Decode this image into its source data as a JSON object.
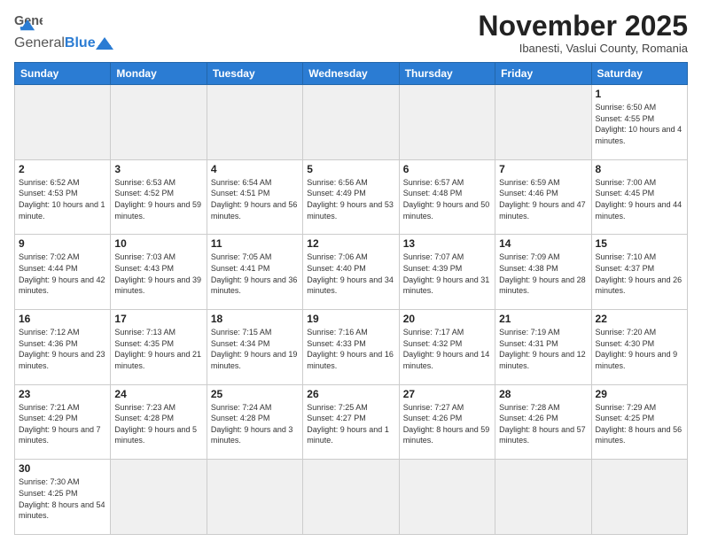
{
  "header": {
    "logo_general": "General",
    "logo_blue": "Blue",
    "month_title": "November 2025",
    "subtitle": "Ibanesti, Vaslui County, Romania"
  },
  "weekdays": [
    "Sunday",
    "Monday",
    "Tuesday",
    "Wednesday",
    "Thursday",
    "Friday",
    "Saturday"
  ],
  "weeks": [
    [
      {
        "day": "",
        "info": "",
        "empty": true
      },
      {
        "day": "",
        "info": "",
        "empty": true
      },
      {
        "day": "",
        "info": "",
        "empty": true
      },
      {
        "day": "",
        "info": "",
        "empty": true
      },
      {
        "day": "",
        "info": "",
        "empty": true
      },
      {
        "day": "",
        "info": "",
        "empty": true
      },
      {
        "day": "1",
        "info": "Sunrise: 6:50 AM\nSunset: 4:55 PM\nDaylight: 10 hours and 4 minutes."
      }
    ],
    [
      {
        "day": "2",
        "info": "Sunrise: 6:52 AM\nSunset: 4:53 PM\nDaylight: 10 hours and 1 minute."
      },
      {
        "day": "3",
        "info": "Sunrise: 6:53 AM\nSunset: 4:52 PM\nDaylight: 9 hours and 59 minutes."
      },
      {
        "day": "4",
        "info": "Sunrise: 6:54 AM\nSunset: 4:51 PM\nDaylight: 9 hours and 56 minutes."
      },
      {
        "day": "5",
        "info": "Sunrise: 6:56 AM\nSunset: 4:49 PM\nDaylight: 9 hours and 53 minutes."
      },
      {
        "day": "6",
        "info": "Sunrise: 6:57 AM\nSunset: 4:48 PM\nDaylight: 9 hours and 50 minutes."
      },
      {
        "day": "7",
        "info": "Sunrise: 6:59 AM\nSunset: 4:46 PM\nDaylight: 9 hours and 47 minutes."
      },
      {
        "day": "8",
        "info": "Sunrise: 7:00 AM\nSunset: 4:45 PM\nDaylight: 9 hours and 44 minutes."
      }
    ],
    [
      {
        "day": "9",
        "info": "Sunrise: 7:02 AM\nSunset: 4:44 PM\nDaylight: 9 hours and 42 minutes."
      },
      {
        "day": "10",
        "info": "Sunrise: 7:03 AM\nSunset: 4:43 PM\nDaylight: 9 hours and 39 minutes."
      },
      {
        "day": "11",
        "info": "Sunrise: 7:05 AM\nSunset: 4:41 PM\nDaylight: 9 hours and 36 minutes."
      },
      {
        "day": "12",
        "info": "Sunrise: 7:06 AM\nSunset: 4:40 PM\nDaylight: 9 hours and 34 minutes."
      },
      {
        "day": "13",
        "info": "Sunrise: 7:07 AM\nSunset: 4:39 PM\nDaylight: 9 hours and 31 minutes."
      },
      {
        "day": "14",
        "info": "Sunrise: 7:09 AM\nSunset: 4:38 PM\nDaylight: 9 hours and 28 minutes."
      },
      {
        "day": "15",
        "info": "Sunrise: 7:10 AM\nSunset: 4:37 PM\nDaylight: 9 hours and 26 minutes."
      }
    ],
    [
      {
        "day": "16",
        "info": "Sunrise: 7:12 AM\nSunset: 4:36 PM\nDaylight: 9 hours and 23 minutes."
      },
      {
        "day": "17",
        "info": "Sunrise: 7:13 AM\nSunset: 4:35 PM\nDaylight: 9 hours and 21 minutes."
      },
      {
        "day": "18",
        "info": "Sunrise: 7:15 AM\nSunset: 4:34 PM\nDaylight: 9 hours and 19 minutes."
      },
      {
        "day": "19",
        "info": "Sunrise: 7:16 AM\nSunset: 4:33 PM\nDaylight: 9 hours and 16 minutes."
      },
      {
        "day": "20",
        "info": "Sunrise: 7:17 AM\nSunset: 4:32 PM\nDaylight: 9 hours and 14 minutes."
      },
      {
        "day": "21",
        "info": "Sunrise: 7:19 AM\nSunset: 4:31 PM\nDaylight: 9 hours and 12 minutes."
      },
      {
        "day": "22",
        "info": "Sunrise: 7:20 AM\nSunset: 4:30 PM\nDaylight: 9 hours and 9 minutes."
      }
    ],
    [
      {
        "day": "23",
        "info": "Sunrise: 7:21 AM\nSunset: 4:29 PM\nDaylight: 9 hours and 7 minutes."
      },
      {
        "day": "24",
        "info": "Sunrise: 7:23 AM\nSunset: 4:28 PM\nDaylight: 9 hours and 5 minutes."
      },
      {
        "day": "25",
        "info": "Sunrise: 7:24 AM\nSunset: 4:28 PM\nDaylight: 9 hours and 3 minutes."
      },
      {
        "day": "26",
        "info": "Sunrise: 7:25 AM\nSunset: 4:27 PM\nDaylight: 9 hours and 1 minute."
      },
      {
        "day": "27",
        "info": "Sunrise: 7:27 AM\nSunset: 4:26 PM\nDaylight: 8 hours and 59 minutes."
      },
      {
        "day": "28",
        "info": "Sunrise: 7:28 AM\nSunset: 4:26 PM\nDaylight: 8 hours and 57 minutes."
      },
      {
        "day": "29",
        "info": "Sunrise: 7:29 AM\nSunset: 4:25 PM\nDaylight: 8 hours and 56 minutes."
      }
    ],
    [
      {
        "day": "30",
        "info": "Sunrise: 7:30 AM\nSunset: 4:25 PM\nDaylight: 8 hours and 54 minutes.",
        "last": true
      },
      {
        "day": "",
        "info": "",
        "empty": true,
        "last": true
      },
      {
        "day": "",
        "info": "",
        "empty": true,
        "last": true
      },
      {
        "day": "",
        "info": "",
        "empty": true,
        "last": true
      },
      {
        "day": "",
        "info": "",
        "empty": true,
        "last": true
      },
      {
        "day": "",
        "info": "",
        "empty": true,
        "last": true
      },
      {
        "day": "",
        "info": "",
        "empty": true,
        "last": true
      }
    ]
  ]
}
